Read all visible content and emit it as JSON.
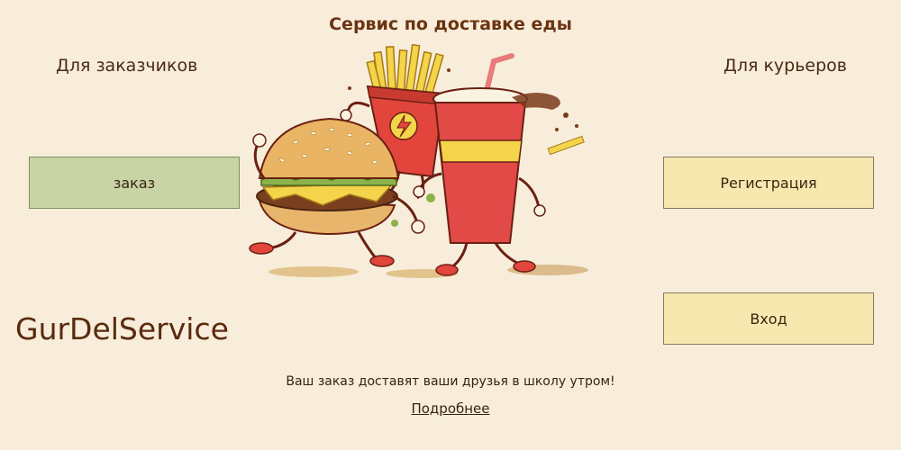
{
  "header": {
    "title": "Сервис по доставке еды"
  },
  "customers": {
    "label": "Для заказчиков",
    "order_button": "заказ"
  },
  "couriers": {
    "label": "Для курьеров",
    "register_button": "Регистрация",
    "login_button": "Вход"
  },
  "brand": {
    "name": "GurDelService"
  },
  "footer": {
    "tagline": "Ваш заказ доставят ваши друзья в школу утром!",
    "more_link": "Подробнее"
  },
  "illustration": {
    "icon": "fast-food-characters-illustration"
  },
  "colors": {
    "background": "#f7edda",
    "order_button": "#c8d4a4",
    "courier_buttons": "#f7e8b0",
    "text_brown": "#5a2e12"
  }
}
